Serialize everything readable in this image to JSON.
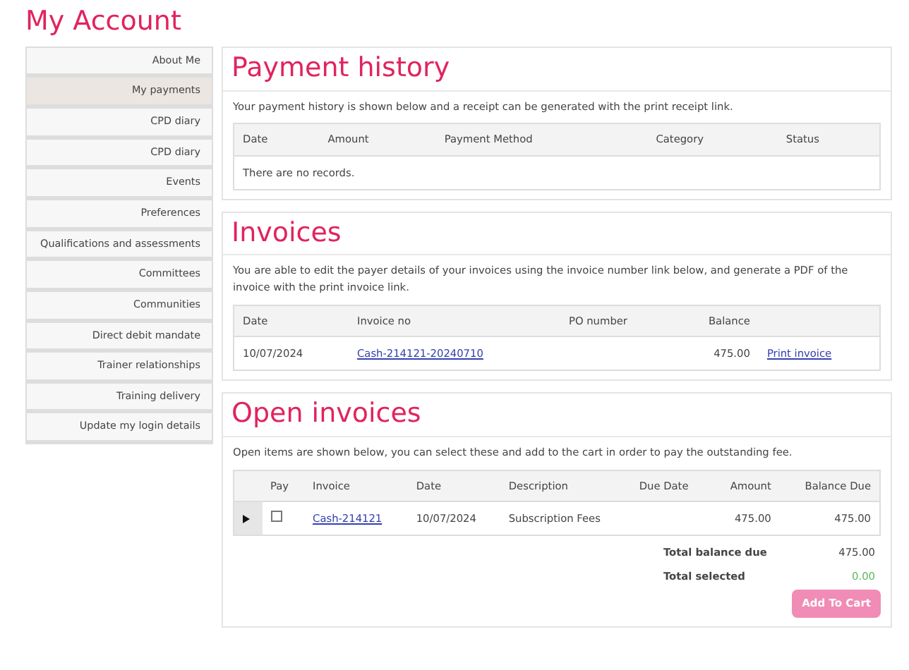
{
  "page_title": "My Account",
  "sidebar": {
    "items": [
      {
        "label": "About Me",
        "selected": false
      },
      {
        "label": "My payments",
        "selected": true
      },
      {
        "label": "CPD diary",
        "selected": false
      },
      {
        "label": "CPD diary",
        "selected": false
      },
      {
        "label": "Events",
        "selected": false
      },
      {
        "label": "Preferences",
        "selected": false
      },
      {
        "label": "Qualifications and assessments",
        "selected": false
      },
      {
        "label": "Committees",
        "selected": false
      },
      {
        "label": "Communities",
        "selected": false
      },
      {
        "label": "Direct debit mandate",
        "selected": false
      },
      {
        "label": "Trainer relationships",
        "selected": false
      },
      {
        "label": "Training delivery",
        "selected": false
      },
      {
        "label": "Update my login details",
        "selected": false
      }
    ]
  },
  "payment_history": {
    "title": "Payment history",
    "description": "Your payment history is shown below and a receipt can be generated with the print receipt link.",
    "columns": [
      "Date",
      "Amount",
      "Payment Method",
      "Category",
      "Status"
    ],
    "empty_message": "There are no records."
  },
  "invoices": {
    "title": "Invoices",
    "description": "You are able to edit the payer details of your invoices using the invoice number link below, and generate a PDF of the invoice with the print invoice link.",
    "columns": [
      "Date",
      "Invoice no",
      "PO number",
      "Balance"
    ],
    "rows": [
      {
        "date": "10/07/2024",
        "invoice_no": "Cash-214121-20240710",
        "balance": "475.00",
        "action": "Print invoice"
      }
    ]
  },
  "open_invoices": {
    "title": "Open invoices",
    "description": "Open items are shown below, you can select these and add to the cart in order to pay the outstanding fee.",
    "columns": [
      "Pay",
      "Invoice",
      "Date",
      "Description",
      "Due Date",
      "Amount",
      "Balance Due"
    ],
    "rows": [
      {
        "expanded": false,
        "checked": false,
        "invoice": "Cash-214121",
        "date": "10/07/2024",
        "description": "Subscription Fees",
        "amount": "475.00",
        "balance_due": "475.00"
      }
    ],
    "totals": [
      {
        "label": "Total balance due",
        "value": "475.00",
        "kind": "due"
      },
      {
        "label": "Total selected",
        "value": "0.00",
        "kind": "selected"
      }
    ],
    "button": {
      "label": "Add To Cart",
      "disabled": true
    }
  }
}
